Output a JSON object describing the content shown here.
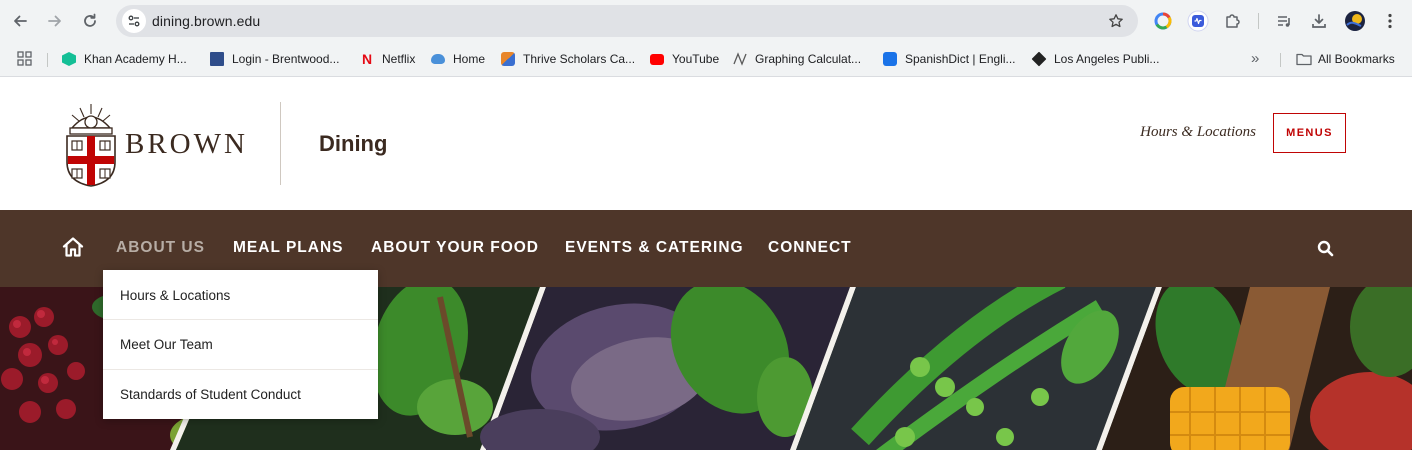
{
  "browser": {
    "url": "dining.brown.edu",
    "bookmarks": [
      {
        "label": "Khan Academy H...",
        "icon": "khan-academy-icon",
        "color": "#14bf96"
      },
      {
        "label": "Login - Brentwood...",
        "icon": "brentwood-icon",
        "color": "#2f4d8a"
      },
      {
        "label": "Netflix",
        "icon": "netflix-icon",
        "color": "#e50914"
      },
      {
        "label": "Home",
        "icon": "home-cloud-icon",
        "color": "#4a90d9"
      },
      {
        "label": "Thrive Scholars Ca...",
        "icon": "thrive-scholars-icon",
        "color": "#e8862a"
      },
      {
        "label": "YouTube",
        "icon": "youtube-icon",
        "color": "#ff0000"
      },
      {
        "label": "Graphing Calculat...",
        "icon": "desmos-icon",
        "color": "#5a5a5a"
      },
      {
        "label": "SpanishDict | Engli...",
        "icon": "spanishdict-icon",
        "color": "#1a73e8"
      },
      {
        "label": "Los Angeles Publi...",
        "icon": "lapl-icon",
        "color": "#222222"
      }
    ],
    "all_bookmarks_label": "All Bookmarks",
    "overflow_label": "»"
  },
  "header": {
    "brand": "BROWN",
    "department": "Dining",
    "hours_link": "Hours & Locations",
    "menus_button": "MENUS"
  },
  "nav": {
    "items": [
      "ABOUT US",
      "MEAL PLANS",
      "ABOUT YOUR FOOD",
      "EVENTS & CATERING",
      "CONNECT"
    ],
    "active": "ABOUT US"
  },
  "dropdown": {
    "items": [
      "Hours & Locations",
      "Meet Our Team",
      "Standards of Student Conduct"
    ]
  },
  "colors": {
    "nav_bg": "#4e3629",
    "accent_red": "#c00404",
    "brand_brown": "#3b2a20"
  }
}
